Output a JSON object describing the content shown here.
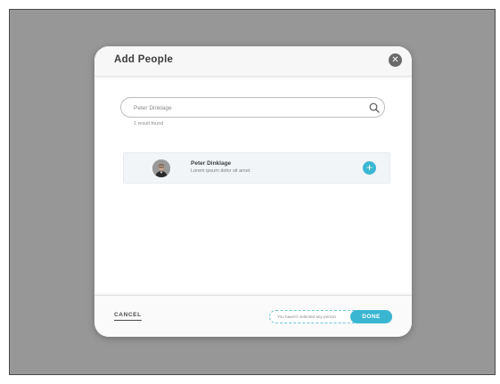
{
  "modal": {
    "title": "Add People",
    "close_icon": "close-icon"
  },
  "search": {
    "value": "Peter Dinklage",
    "icon": "search-icon",
    "result_count": "1 result found"
  },
  "results": [
    {
      "name": "Peter Dinklage",
      "description": "Lorem ipsum dolor sit amet.",
      "avatar_icon": "avatar",
      "action_icon": "plus-icon"
    }
  ],
  "footer": {
    "cancel_label": "CANCEL",
    "selection_status": "You haven't selected any person",
    "done_label": "DONE"
  },
  "colors": {
    "accent": "#3ab6d3",
    "overlay": "#979797",
    "close_button": "#6a6a6a"
  }
}
